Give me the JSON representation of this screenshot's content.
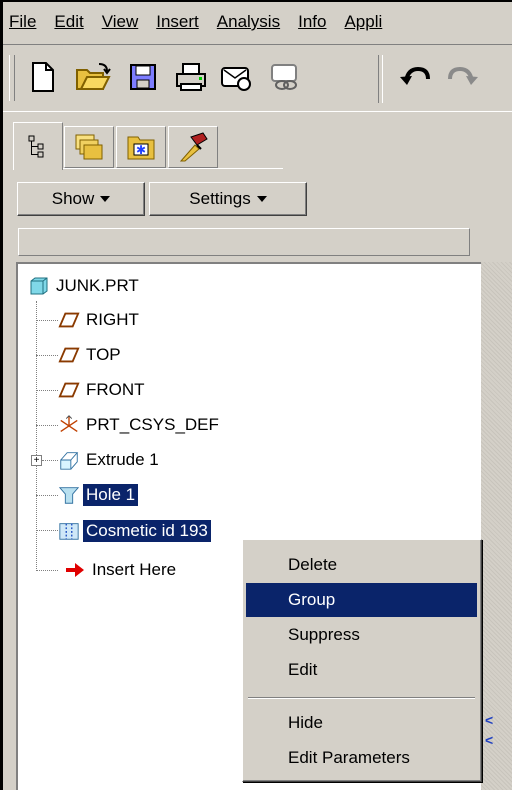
{
  "menubar": {
    "items": [
      {
        "label": "File"
      },
      {
        "label": "Edit"
      },
      {
        "label": "View"
      },
      {
        "label": "Insert"
      },
      {
        "label": "Analysis"
      },
      {
        "label": "Info"
      },
      {
        "label": "Appli"
      }
    ]
  },
  "toolbar": {
    "icons": [
      "new-file-icon",
      "open-folder-icon",
      "save-icon",
      "print-icon",
      "send-mail-icon",
      "mail-link-icon",
      "undo-icon",
      "redo-icon"
    ]
  },
  "navigator": {
    "tabs": [
      "model-tree-icon",
      "folder-browser-icon",
      "favorites-icon",
      "connections-icon"
    ],
    "show_label": "Show",
    "settings_label": "Settings",
    "tree": [
      {
        "label": "JUNK.PRT",
        "icon": "part-icon",
        "selected": false
      },
      {
        "label": "RIGHT",
        "icon": "datum-plane-icon",
        "selected": false
      },
      {
        "label": "TOP",
        "icon": "datum-plane-icon",
        "selected": false
      },
      {
        "label": "FRONT",
        "icon": "datum-plane-icon",
        "selected": false
      },
      {
        "label": "PRT_CSYS_DEF",
        "icon": "csys-icon",
        "selected": false
      },
      {
        "label": "Extrude 1",
        "icon": "extrude-icon",
        "selected": false,
        "expandable": true
      },
      {
        "label": "Hole 1",
        "icon": "hole-icon",
        "selected": true
      },
      {
        "label": "Cosmetic id 193",
        "icon": "cosmetic-icon",
        "selected": true
      },
      {
        "label": "Insert Here",
        "icon": "insert-arrow-icon",
        "selected": false
      }
    ]
  },
  "context_menu": {
    "items": [
      {
        "label": "Delete",
        "highlighted": false
      },
      {
        "label": "Group",
        "highlighted": true
      },
      {
        "label": "Suppress",
        "highlighted": false
      },
      {
        "label": "Edit",
        "highlighted": false
      },
      {
        "label": "Hide",
        "highlighted": false
      },
      {
        "label": "Edit Parameters",
        "highlighted": false
      }
    ]
  },
  "colors": {
    "chrome": "#d4d0c8",
    "selection": "#0a246a",
    "tree_bg": "#ffffff"
  }
}
